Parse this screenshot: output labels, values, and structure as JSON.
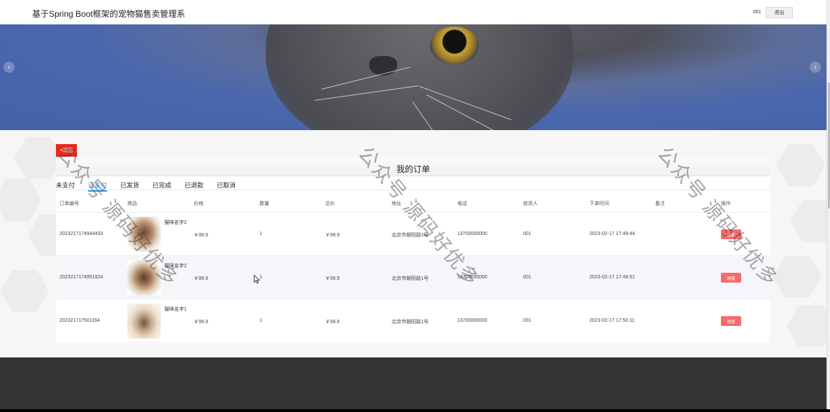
{
  "header": {
    "title": "基于Spring Boot框架的宠物猫售卖管理系",
    "username": "001",
    "logout_label": "退出"
  },
  "carousel": {
    "prev_glyph": "‹",
    "next_glyph": "›"
  },
  "back_label": "<返回",
  "page_title": "我的订单",
  "tabs": [
    {
      "label": "未支付",
      "active": false
    },
    {
      "label": "已支付",
      "active": true
    },
    {
      "label": "已发货",
      "active": false
    },
    {
      "label": "已完成",
      "active": false
    },
    {
      "label": "已退款",
      "active": false
    },
    {
      "label": "已取消",
      "active": false
    }
  ],
  "columns": [
    "订单编号",
    "商品",
    "价格",
    "数量",
    "总价",
    "地址",
    "电话",
    "收货人",
    "下单时间",
    "备注",
    "操作"
  ],
  "orders": [
    {
      "order_no": "2023217174944433",
      "goods_name": "猫咪名字2",
      "price": "￥99.9",
      "qty": "1",
      "total": "￥99.9",
      "address": "北京市朝阳路1号",
      "phone": "13700000000",
      "receiver": "001",
      "time": "2023-02-17 17:49:44",
      "remark": "",
      "action": "退款"
    },
    {
      "order_no": "2023217174951924",
      "goods_name": "猫咪名字2",
      "price": "￥99.9",
      "qty": "1",
      "total": "￥99.9",
      "address": "北京市朝阳路1号",
      "phone": "13700000000",
      "receiver": "001",
      "time": "2023-02-17 17:49:51",
      "remark": "",
      "action": "退款"
    },
    {
      "order_no": "202321717501164",
      "goods_name": "猫咪名字1",
      "price": "￥99.9",
      "qty": "1",
      "total": "￥99.9",
      "address": "北京市朝阳路1号",
      "phone": "13700000000",
      "receiver": "001",
      "time": "2023-02-17 17:50:11",
      "remark": "",
      "action": "退款"
    }
  ],
  "watermark": "公众号 源码好优多"
}
